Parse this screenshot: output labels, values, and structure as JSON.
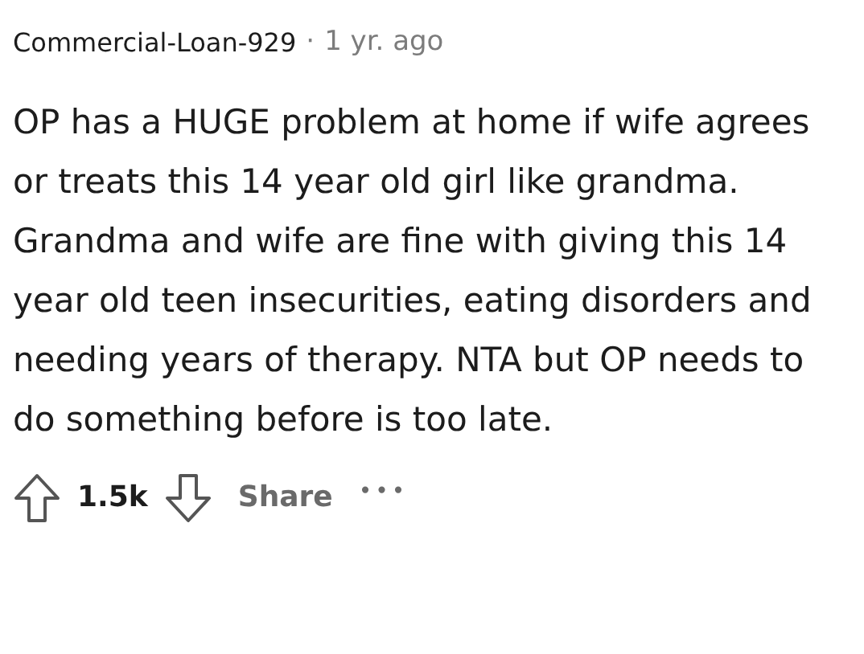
{
  "comment": {
    "author": "Commercial-Loan-929",
    "separator": "·",
    "time": "1 yr. ago",
    "body": "OP has a HUGE problem at home if wife agrees or treats this 14 year old girl like grandma. Grandma and wife are fine with giving this 14 year old teen insecurities, eating disorders and needing years of therapy. NTA but OP needs to do something before is too late.",
    "score": "1.5k",
    "share": "Share",
    "more": "•••"
  }
}
